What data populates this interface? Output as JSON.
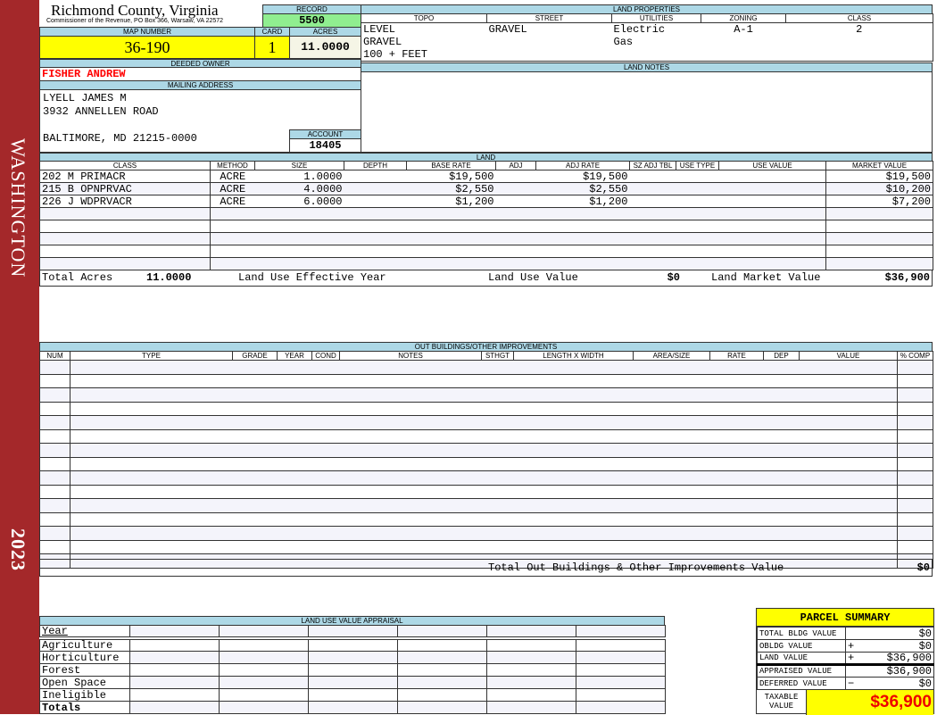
{
  "sidebar": {
    "district": "WASHINGTON",
    "year": "2023"
  },
  "header": {
    "title": "Richmond County, Virginia",
    "subtitle": "Commissioner of the Revenue, PO Box 366, Warsaw, VA 22572"
  },
  "record": {
    "label": "RECORD",
    "value": "5500"
  },
  "map": {
    "label": "MAP NUMBER",
    "value": "36-190"
  },
  "card": {
    "label": "CARD",
    "value": "1"
  },
  "acres": {
    "label": "ACRES",
    "value": "11.0000"
  },
  "owner": {
    "label": "DEEDED OWNER",
    "value": "FISHER ANDREW"
  },
  "mailing": {
    "label": "MAILING ADDRESS",
    "line1": "LYELL JAMES M",
    "line2": "3932 ANNELLEN ROAD",
    "line3": "BALTIMORE, MD 21215-0000"
  },
  "account": {
    "label": "ACCOUNT",
    "value": "18405"
  },
  "land_properties": {
    "label": "LAND PROPERTIES",
    "headers": [
      "TOPO",
      "STREET",
      "UTILITIES",
      "ZONING",
      "CLASS"
    ],
    "topo": [
      "LEVEL",
      "GRAVEL",
      "100 + FEET"
    ],
    "street": "GRAVEL",
    "utilities": [
      "Electric",
      "Gas"
    ],
    "zoning": "A-1",
    "class": "2"
  },
  "land_notes": {
    "label": "LAND NOTES"
  },
  "land": {
    "label": "LAND",
    "headers": [
      "CLASS",
      "METHOD",
      "SIZE",
      "DEPTH",
      "BASE RATE",
      "ADJ",
      "ADJ RATE",
      "SZ ADJ TBL",
      "USE TYPE",
      "USE VALUE",
      "MARKET VALUE"
    ],
    "rows": [
      [
        "202 M PRIMACR",
        "ACRE",
        "1.0000",
        "",
        "$19,500",
        "",
        "$19,500",
        "",
        "",
        "",
        "$19,500"
      ],
      [
        "215 B OPNPRVAC",
        "ACRE",
        "4.0000",
        "",
        "$2,550",
        "",
        "$2,550",
        "",
        "",
        "",
        "$10,200"
      ],
      [
        "226 J WDPRVACR",
        "ACRE",
        "6.0000",
        "",
        "$1,200",
        "",
        "$1,200",
        "",
        "",
        "",
        "$7,200"
      ]
    ],
    "totals": {
      "acres_label": "Total Acres",
      "acres": "11.0000",
      "eff_year_label": "Land Use Effective Year",
      "use_value_label": "Land Use Value",
      "use_value": "$0",
      "market_label": "Land Market Value",
      "market": "$36,900"
    }
  },
  "outbuildings": {
    "label": "OUT BUILDINGS/OTHER IMPROVEMENTS",
    "headers": [
      "NUM",
      "TYPE",
      "GRADE",
      "YEAR",
      "COND",
      "NOTES",
      "STHGT",
      "LENGTH X WIDTH",
      "AREA/SIZE",
      "RATE",
      "DEP",
      "VALUE",
      "% COMP"
    ],
    "total_label": "Total Out Buildings & Other Improvements Value",
    "total": "$0"
  },
  "land_use": {
    "label": "LAND USE VALUE APPRAISAL",
    "year_label": "Year",
    "rows": [
      "Agriculture",
      "Horticulture",
      "Forest",
      "Open Space",
      "Ineligible"
    ],
    "totals_label": "Totals"
  },
  "summary": {
    "title": "PARCEL SUMMARY",
    "rows": [
      {
        "label": "TOTAL BLDG VALUE",
        "op": "",
        "value": "$0"
      },
      {
        "label": "OBLDG VALUE",
        "op": "+",
        "value": "$0"
      },
      {
        "label": "LAND VALUE",
        "op": "+",
        "value": "$36,900"
      },
      {
        "label": "APPRAISED VALUE",
        "op": "",
        "value": "$36,900"
      },
      {
        "label": "DEFERRED VALUE",
        "op": "−",
        "value": "$0"
      }
    ],
    "taxable_label": "TAXABLE VALUE",
    "taxable": "$36,900"
  },
  "colors": {
    "sidebar": "#a4282a",
    "label_bg": "#add8e6",
    "highlight": "#ffff00",
    "record": "#90ee90",
    "owner": "#ff0000"
  }
}
